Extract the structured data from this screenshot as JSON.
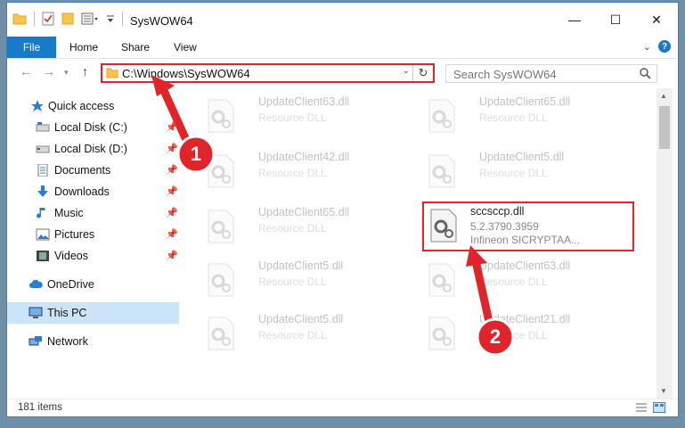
{
  "window": {
    "title": "SysWOW64",
    "controls": {
      "minimize": "—",
      "maximize": "☐",
      "close": "✕"
    }
  },
  "ribbon": {
    "tabs": [
      "File",
      "Home",
      "Share",
      "View"
    ],
    "expand": "⌄",
    "help": "?"
  },
  "address": {
    "path": "C:\\Windows\\SysWOW64",
    "search_placeholder": "Search SysWOW64"
  },
  "sidebar": {
    "items": [
      {
        "label": "Quick access",
        "icon": "star-icon"
      },
      {
        "label": "Local Disk (C:)",
        "icon": "drive-icon"
      },
      {
        "label": "Local Disk (D:)",
        "icon": "drive-icon"
      },
      {
        "label": "Documents",
        "icon": "documents-icon"
      },
      {
        "label": "Downloads",
        "icon": "downloads-icon"
      },
      {
        "label": "Music",
        "icon": "music-icon"
      },
      {
        "label": "Pictures",
        "icon": "pictures-icon"
      },
      {
        "label": "Videos",
        "icon": "videos-icon"
      },
      {
        "label": "OneDrive",
        "icon": "cloud-icon"
      },
      {
        "label": "This PC",
        "icon": "computer-icon"
      },
      {
        "label": "Network",
        "icon": "network-icon"
      }
    ]
  },
  "files": [
    {
      "name": "UpdateClient63.dll",
      "desc": "Resource DLL"
    },
    {
      "name": "UpdateClient65.dll",
      "desc": "Resource DLL"
    },
    {
      "name": "UpdateClient42.dll",
      "desc": "Resource DLL"
    },
    {
      "name": "UpdateClient5.dll",
      "desc": "Resource DLL"
    },
    {
      "name": "UpdateClient65.dll",
      "desc": "Resource DLL"
    },
    {
      "name": "sccsccp.dll",
      "desc": "5.2.3790.3959",
      "sub": "Infineon SICRYPTAA..."
    },
    {
      "name": "UpdateClient5.dll",
      "desc": "Resource DLL"
    },
    {
      "name": "UpdateClient63.dll",
      "desc": "Resource DLL"
    },
    {
      "name": "UpdateClient5.dll",
      "desc": "Resource DLL"
    },
    {
      "name": "UpdateClient21.dll",
      "desc": "Resource DLL"
    }
  ],
  "status": {
    "count": "181 items"
  },
  "annotations": {
    "step1": "1",
    "step2": "2"
  },
  "colors": {
    "accent": "#1979ca",
    "highlight": "#e0252a",
    "selection": "#cce4f7"
  }
}
